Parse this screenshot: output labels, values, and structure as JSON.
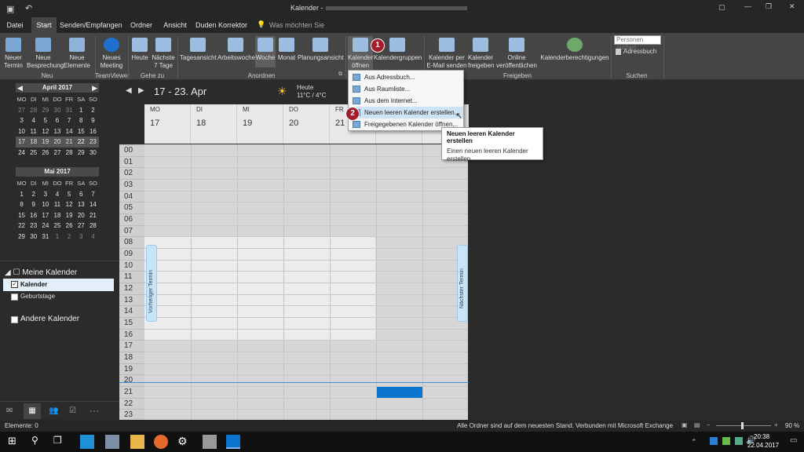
{
  "titlebar": {
    "title": "Kalender -",
    "tell_me": "Was möchten Sie tun?"
  },
  "tabs": [
    "Datei",
    "Start",
    "Senden/Empfangen",
    "Ordner",
    "Ansicht",
    "Duden Korrektor"
  ],
  "ribbon": {
    "neu": {
      "termin": "Neuer Termin",
      "besprechung": "Neue Besprechung",
      "elemente": "Neue Elemente",
      "group": "Neu"
    },
    "teamviewer": {
      "meeting": "Neues Meeting",
      "group": "TeamViewer"
    },
    "gehezu": {
      "heute": "Heute",
      "naechste": "Nächste 7 Tage",
      "group": "Gehe zu"
    },
    "anordnen": {
      "tagesansicht": "Tagesansicht",
      "arbeitswoche": "Arbeitswoche",
      "woche": "Woche",
      "monat": "Monat",
      "planungsansicht": "Planungsansicht",
      "group": "Anordnen"
    },
    "kalender": {
      "oeffnen": "Kalender öffnen",
      "gruppen": "Kalendergruppen",
      "email": "Kalender per E-Mail senden",
      "freigeben": "Kalender freigeben",
      "online": "Online veröffentlichen",
      "berechtigungen": "Kalenderberechtigungen",
      "group": "Freigeben"
    },
    "suchen": {
      "personen": "Personen suchen",
      "adressbuch": "Adressbuch",
      "group": "Suchen"
    }
  },
  "mini_april": {
    "title": "April 2017",
    "days": [
      "MO",
      "DI",
      "MI",
      "DO",
      "FR",
      "SA",
      "SO"
    ],
    "rows": [
      [
        "27",
        "28",
        "29",
        "30",
        "31",
        "1",
        "2"
      ],
      [
        "3",
        "4",
        "5",
        "6",
        "7",
        "8",
        "9"
      ],
      [
        "10",
        "11",
        "12",
        "13",
        "14",
        "15",
        "16"
      ],
      [
        "17",
        "18",
        "19",
        "20",
        "21",
        "22",
        "23"
      ],
      [
        "24",
        "25",
        "26",
        "27",
        "28",
        "29",
        "30"
      ]
    ]
  },
  "mini_mai": {
    "title": "Mai 2017",
    "days": [
      "MO",
      "DI",
      "MI",
      "DO",
      "FR",
      "SA",
      "SO"
    ],
    "rows": [
      [
        "1",
        "2",
        "3",
        "4",
        "5",
        "6",
        "7"
      ],
      [
        "8",
        "9",
        "10",
        "11",
        "12",
        "13",
        "14"
      ],
      [
        "15",
        "16",
        "17",
        "18",
        "19",
        "20",
        "21"
      ],
      [
        "22",
        "23",
        "24",
        "25",
        "26",
        "27",
        "28"
      ],
      [
        "29",
        "30",
        "31",
        "1",
        "2",
        "3",
        "4"
      ]
    ]
  },
  "folders": {
    "meine": "Meine Kalender",
    "kalender": "Kalender",
    "geburtstage": "Geburtstage",
    "andere": "Andere Kalender"
  },
  "calendar": {
    "range": "17 - 23. Apr",
    "weather_label": "Heute",
    "weather": "11°C / 4°C",
    "days": [
      {
        "name": "MO",
        "num": "17"
      },
      {
        "name": "DI",
        "num": "18"
      },
      {
        "name": "MI",
        "num": "19"
      },
      {
        "name": "DO",
        "num": "20"
      },
      {
        "name": "FR",
        "num": "21"
      },
      {
        "name": "",
        "num": ""
      },
      {
        "name": "",
        "num": ""
      }
    ],
    "hours": [
      "00",
      "01",
      "02",
      "03",
      "04",
      "05",
      "06",
      "07",
      "08",
      "09",
      "10",
      "11",
      "12",
      "13",
      "14",
      "15",
      "16",
      "17",
      "18",
      "19",
      "20",
      "21",
      "22",
      "23"
    ],
    "prev": "Vorheriger Termin",
    "next": "Nächster Termin"
  },
  "dropdown": {
    "items": [
      "Aus Adressbuch...",
      "Aus Raumliste...",
      "Aus dem Internet...",
      "Neuen leeren Kalender erstellen...",
      "Freigegebenen Kalender öffnen..."
    ]
  },
  "tooltip": {
    "title": "Neuen leeren Kalender erstellen",
    "body": "Einen neuen leeren Kalender erstellen."
  },
  "badges": [
    "1",
    "2"
  ],
  "status": {
    "elemente": "Elemente: 0",
    "ordner": "Alle Ordner sind auf dem neuesten Stand.",
    "verbunden": "Verbunden mit Microsoft Exchange",
    "zoom": "90 %"
  },
  "taskbar": {
    "time": "20:38",
    "date": "22.04.2017"
  },
  "colors": {
    "accent": "#0a74cc",
    "badge": "#a51c2a"
  }
}
